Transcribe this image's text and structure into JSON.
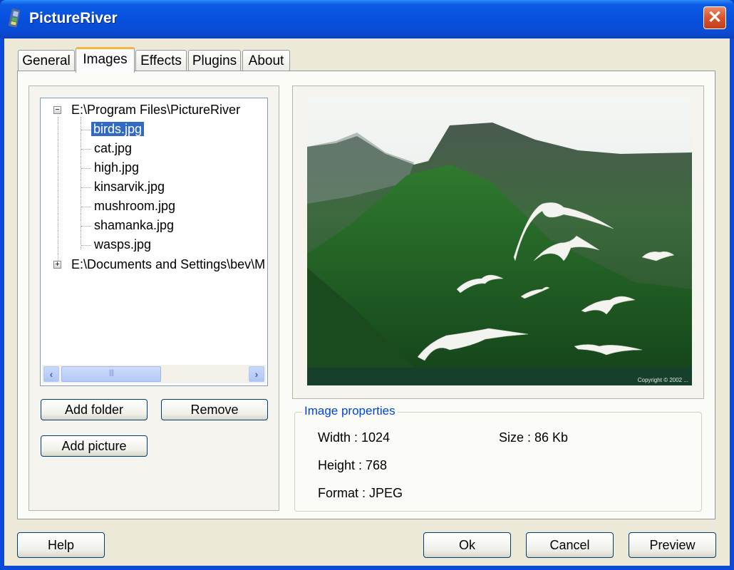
{
  "window": {
    "title": "PictureRiver",
    "icon": "film-strip-icon",
    "close_icon": "close-icon"
  },
  "tabs": [
    {
      "label": "General",
      "active": false
    },
    {
      "label": "Images",
      "active": true
    },
    {
      "label": "Effects",
      "active": false
    },
    {
      "label": "Plugins",
      "active": false
    },
    {
      "label": "About",
      "active": false
    }
  ],
  "tree": {
    "folders": [
      {
        "path": "E:\\Program Files\\PictureRiver",
        "expanded": true,
        "expander": "−",
        "files": [
          "birds.jpg",
          "cat.jpg",
          "high.jpg",
          "kinsarvik.jpg",
          "mushroom.jpg",
          "shamanka.jpg",
          "wasps.jpg"
        ],
        "selected": "birds.jpg"
      },
      {
        "path": "E:\\Documents and Settings\\bev\\M",
        "expanded": false,
        "expander": "+"
      }
    ],
    "scroll_left": "‹",
    "scroll_right": "›",
    "thumb_grip": "||||"
  },
  "buttons": {
    "add_folder": "Add folder",
    "remove": "Remove",
    "add_picture": "Add picture",
    "help": "Help",
    "ok": "Ok",
    "cancel": "Cancel",
    "preview": "Preview"
  },
  "image_properties": {
    "legend": "Image properties",
    "width": "Width : 1024",
    "height": "Height : 768",
    "format": "Format : JPEG",
    "size": "Size : 86 Kb"
  },
  "preview": {
    "subject": "seagulls over green fjord mountains",
    "caption": "Copyright © 2002 ..."
  }
}
